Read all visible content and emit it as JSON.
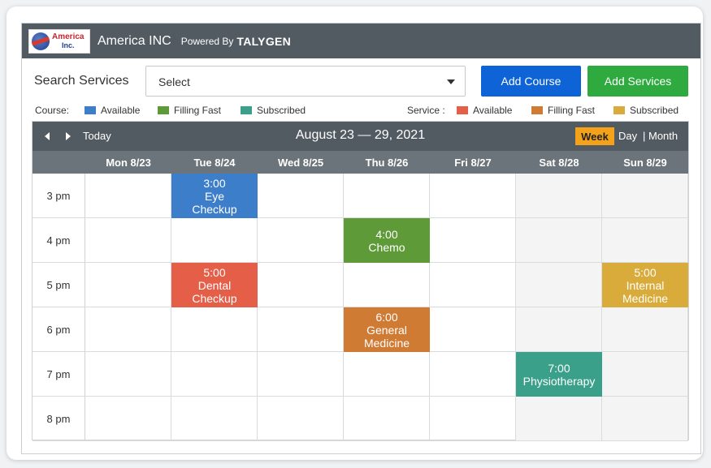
{
  "header": {
    "logo_text_top": "America",
    "logo_text_bottom": "Inc.",
    "app_name": "America INC",
    "powered_by": "Powered By",
    "brand": "TALYGEN"
  },
  "search": {
    "label": "Search Services",
    "select_value": "Select"
  },
  "buttons": {
    "add_course": "Add Course",
    "add_services": "Add Services"
  },
  "legend": {
    "course_label": "Course:",
    "service_label": "Service :",
    "course_items": [
      {
        "label": "Available",
        "color": "#3d7ecb"
      },
      {
        "label": "Filling Fast",
        "color": "#5e9a37"
      },
      {
        "label": "Subscribed",
        "color": "#3aa08a"
      }
    ],
    "service_items": [
      {
        "label": "Available",
        "color": "#e45e48"
      },
      {
        "label": "Filling Fast",
        "color": "#d07b34"
      },
      {
        "label": "Subscribed",
        "color": "#d8ab3a"
      }
    ]
  },
  "calendar": {
    "nav_prev": "prev",
    "nav_next": "next",
    "today": "Today",
    "range": "August 23 — 29, 2021",
    "views": {
      "week": "Week",
      "day": "Day",
      "sep": "|",
      "month": "Month"
    },
    "days": [
      "Mon 8/23",
      "Tue 8/24",
      "Wed 8/25",
      "Thu 8/26",
      "Fri 8/27",
      "Sat 8/28",
      "Sun 8/29"
    ],
    "times": [
      "3 pm",
      "4 pm",
      "5 pm",
      "6 pm",
      "7 pm",
      "8 pm"
    ],
    "events": [
      {
        "day": 1,
        "slot": 0,
        "time": "3:00",
        "title": "Eye Checkup",
        "color": "#3d7ecb"
      },
      {
        "day": 3,
        "slot": 1,
        "time": "4:00",
        "title": "Chemo",
        "color": "#5e9a37"
      },
      {
        "day": 1,
        "slot": 2,
        "time": "5:00",
        "title": "Dental Checkup",
        "color": "#e45e48"
      },
      {
        "day": 6,
        "slot": 2,
        "time": "5:00",
        "title": "Internal Medicine",
        "color": "#d8ab3a"
      },
      {
        "day": 3,
        "slot": 3,
        "time": "6:00",
        "title": "General Medicine",
        "color": "#d07b34"
      },
      {
        "day": 5,
        "slot": 4,
        "time": "7:00",
        "title": "Physiotherapy",
        "color": "#3aa08a"
      }
    ]
  }
}
